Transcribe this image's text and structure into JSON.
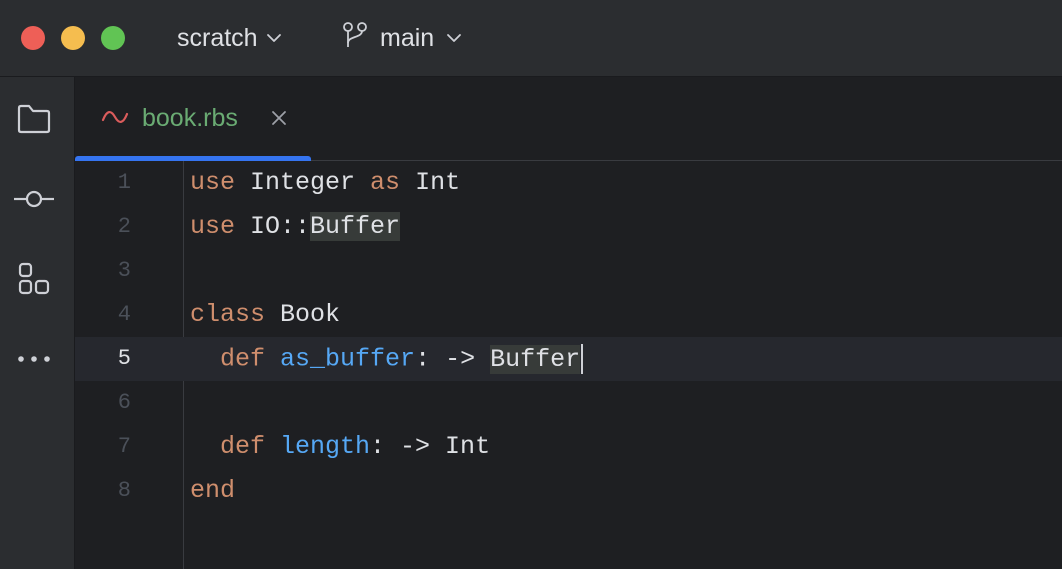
{
  "titlebar": {
    "project": "scratch",
    "branch": "main"
  },
  "sidebar": {
    "items": [
      {
        "icon": "folder-icon"
      },
      {
        "icon": "commit-icon"
      },
      {
        "icon": "structure-icon"
      },
      {
        "icon": "more-icon"
      }
    ]
  },
  "tabs": [
    {
      "label": "book.rbs",
      "active": true,
      "modified": true
    }
  ],
  "editor": {
    "current_line": 5,
    "lines": [
      {
        "number": "1",
        "tokens": [
          {
            "t": "use",
            "k": "kw"
          },
          {
            "t": " Integer ",
            "k": "plain"
          },
          {
            "t": "as",
            "k": "kw"
          },
          {
            "t": " Int",
            "k": "plain"
          }
        ]
      },
      {
        "number": "2",
        "tokens": [
          {
            "t": "use",
            "k": "kw"
          },
          {
            "t": " IO::",
            "k": "plain"
          },
          {
            "t": "Buffer",
            "k": "hl"
          }
        ]
      },
      {
        "number": "3",
        "tokens": []
      },
      {
        "number": "4",
        "tokens": [
          {
            "t": "class",
            "k": "kw"
          },
          {
            "t": " Book",
            "k": "plain"
          }
        ]
      },
      {
        "number": "5",
        "tokens": [
          {
            "t": "  def",
            "k": "kw"
          },
          {
            "t": " ",
            "k": "plain"
          },
          {
            "t": "as_buffer",
            "k": "fn"
          },
          {
            "t": ": -> ",
            "k": "plain"
          },
          {
            "t": "Buffer",
            "k": "hl"
          }
        ]
      },
      {
        "number": "6",
        "tokens": []
      },
      {
        "number": "7",
        "tokens": [
          {
            "t": "  def",
            "k": "kw"
          },
          {
            "t": " ",
            "k": "plain"
          },
          {
            "t": "length",
            "k": "fn"
          },
          {
            "t": ": -> Int",
            "k": "plain"
          }
        ]
      },
      {
        "number": "8",
        "tokens": [
          {
            "t": "end",
            "k": "kw"
          }
        ]
      }
    ]
  },
  "colors": {
    "keyword": "#cf8e6d",
    "function": "#56a8f5",
    "text": "#dfe1e5",
    "tab_label": "#6aab73",
    "accent": "#3574f0"
  }
}
